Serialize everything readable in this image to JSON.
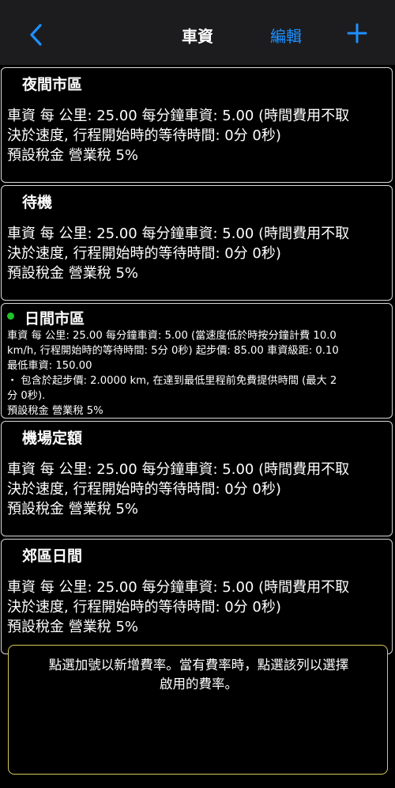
{
  "nav": {
    "back_icon": "chevron-left-icon",
    "title": "車資",
    "edit_label": "編輯",
    "add_icon": "plus-icon",
    "accent_color": "#1e90ff"
  },
  "rates": [
    {
      "name": "夜間市區",
      "active": false,
      "lines": [
        "車資 每 公里: 25.00 每分鐘車資: 5.00 (時間費用不取",
        "決於速度, 行程開始時的等待時間: 0分 0秒)",
        "預設稅金 營業稅 5%"
      ]
    },
    {
      "name": "待機",
      "active": false,
      "lines": [
        "車資 每 公里: 25.00 每分鐘車資: 5.00 (時間費用不取",
        "決於速度, 行程開始時的等待時間: 0分 0秒)",
        "預設稅金 營業稅 5%"
      ]
    },
    {
      "name": "日間市區",
      "active": true,
      "active_color": "#22c02a",
      "lines": [
        "車資 每 公里: 25.00 每分鐘車資: 5.00 (當速度低於時按分鐘計費 10.0",
        "km/h, 行程開始時的等待時間: 5分 0秒) 起步價: 85.00 車資級距: 0.10",
        "最低車資: 150.00",
        "・ 包含於起步價: 2.0000 km, 在達到最低里程前免費提供時間 (最大 2",
        "分 0秒).",
        "預設稅金 營業稅 5%"
      ]
    },
    {
      "name": "機場定額",
      "active": false,
      "lines": [
        "車資 每 公里: 25.00 每分鐘車資: 5.00 (時間費用不取",
        "決於速度, 行程開始時的等待時間: 0分 0秒)",
        "預設稅金 營業稅 5%"
      ]
    },
    {
      "name": "郊區日間",
      "active": false,
      "lines": [
        "車資 每 公里: 25.00 每分鐘車資: 5.00 (時間費用不取",
        "決於速度, 行程開始時的等待時間: 0分 0秒)",
        "預設稅金 營業稅 5%"
      ]
    }
  ],
  "hint": {
    "line1": "點選加號以新增費率。當有費率時，點選該列以選擇",
    "line2": "啟用的費率。",
    "border_color": "#d6c95a"
  }
}
